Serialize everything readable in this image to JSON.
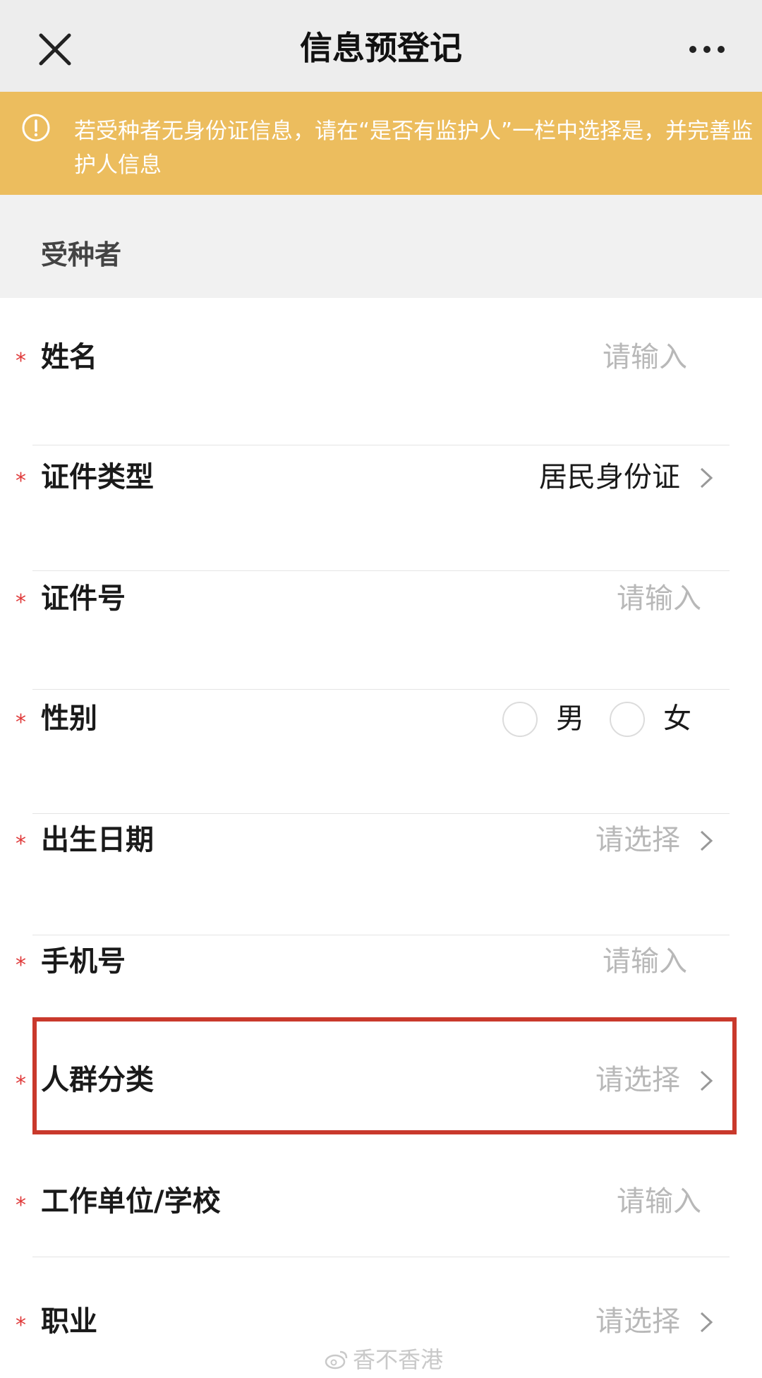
{
  "nav": {
    "title": "信息预登记",
    "close_icon": "close-icon",
    "more_icon": "more-icon"
  },
  "notice": {
    "icon": "info-icon",
    "text": "若受种者无身份证信息，请在“是否有监护人”一栏中选择是，并完善监护人信息",
    "color": "#ecbd5e"
  },
  "section": {
    "title": "受种者"
  },
  "form": {
    "required_mark": "*",
    "fields": [
      {
        "label": "姓名",
        "placeholder": "请输入",
        "value": ""
      },
      {
        "label": "证件类型",
        "value": "居民身份证",
        "placeholder": ""
      },
      {
        "label": "证件号",
        "placeholder": "请输入",
        "value": ""
      },
      {
        "label": "性别",
        "options": [
          "男",
          "女"
        ]
      },
      {
        "label": "出生日期",
        "placeholder": "请选择",
        "value": ""
      },
      {
        "label": "手机号",
        "placeholder": "请输入",
        "value": ""
      },
      {
        "label": "人群分类",
        "placeholder": "请选择",
        "value": ""
      },
      {
        "label": "工作单位/学校",
        "placeholder": "请输入",
        "value": ""
      },
      {
        "label": "职业",
        "placeholder": "请选择",
        "value": ""
      }
    ]
  },
  "watermark": {
    "text": "香不香港"
  },
  "colors": {
    "required": "#e03a3a",
    "highlight": "#c9392c",
    "placeholder": "#b8b8b8"
  }
}
